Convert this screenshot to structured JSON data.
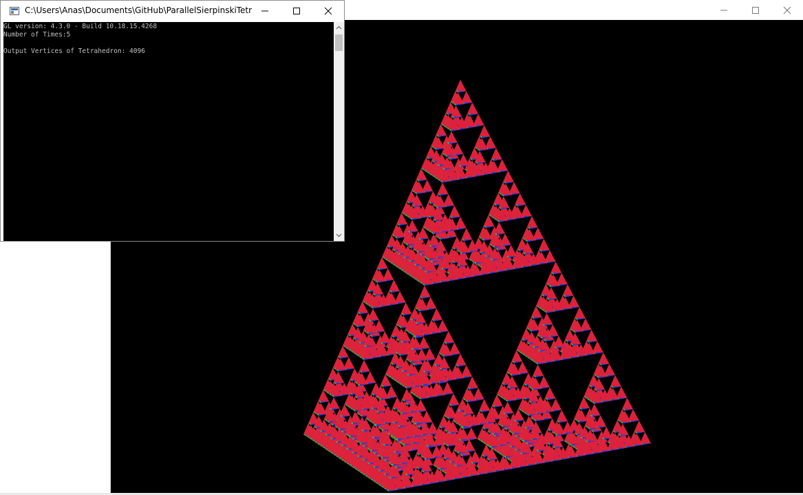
{
  "console": {
    "title": "C:\\Users\\Anas\\Documents\\GitHub\\ParallelSierpinskiTetrahe...",
    "lines": [
      "GL version: 4.3.0 - Build 10.18.15.4268",
      "Number of Times:5",
      "",
      "Output Vertices of Tetrahedron: 4096"
    ]
  },
  "gl_window": {
    "scene": "sierpinski-tetrahedron",
    "recursion_depth": 5,
    "vertex_colors": [
      "#e0203a",
      "#22c24a",
      "#2a3ad8"
    ],
    "background_color": "#000000"
  },
  "icons": {
    "minimize": "minimize-icon",
    "maximize": "maximize-icon",
    "close": "close-icon",
    "console_app": "console-app-icon",
    "scroll_up": "chevron-up-icon",
    "scroll_down": "chevron-down-icon"
  }
}
